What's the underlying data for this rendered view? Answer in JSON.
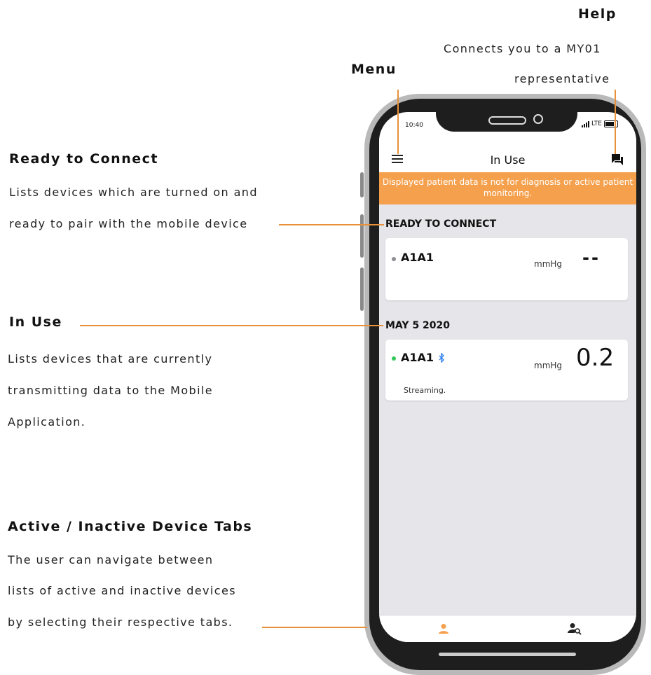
{
  "annotations": {
    "help": {
      "title": "Help",
      "lines": [
        "Connects you to a MY01",
        "representative"
      ]
    },
    "menu": {
      "title": "Menu"
    },
    "ready_to_connect": {
      "title": "Ready to Connect",
      "lines": [
        "Lists devices which are turned on  and",
        "ready to pair with the mobile device"
      ]
    },
    "in_use": {
      "title": "In Use",
      "lines": [
        "Lists devices that are currently",
        "transmitting data to the Mobile",
        "Application."
      ]
    },
    "tabs": {
      "title": "Active / Inactive Device Tabs",
      "lines": [
        "The user can navigate between",
        "lists of active and inactive devices",
        "by selecting their respective tabs."
      ]
    }
  },
  "status_bar": {
    "time": "10:40",
    "network": "LTE"
  },
  "nav": {
    "title": "In Use",
    "menu_icon": "hamburger-menu-icon",
    "help_icon": "chat-bubbles-icon"
  },
  "banner": {
    "text": "Displayed patient data is not for diagnosis or active patient monitoring.",
    "color": "#f5a04d"
  },
  "sections": [
    {
      "header": "READY TO CONNECT",
      "device": {
        "name": "A1A1",
        "unit": "mmHg",
        "value": "--",
        "status": "",
        "dot_color": "#8e8e93",
        "bluetooth": false
      }
    },
    {
      "header": "MAY 5 2020",
      "device": {
        "name": "A1A1",
        "unit": "mmHg",
        "value": "0.2",
        "status": "Streaming.",
        "dot_color": "#34c759",
        "bluetooth": true
      }
    }
  ],
  "tabs": [
    {
      "name": "active-devices",
      "icon": "person-icon",
      "active": true,
      "color": "#f5a04d"
    },
    {
      "name": "inactive-devices",
      "icon": "person-search-icon",
      "active": false,
      "color": "#222222"
    }
  ],
  "colors": {
    "accent": "#f5a04d",
    "annotation_line": "#e8913b",
    "screen_bg": "#e5e5ea"
  }
}
